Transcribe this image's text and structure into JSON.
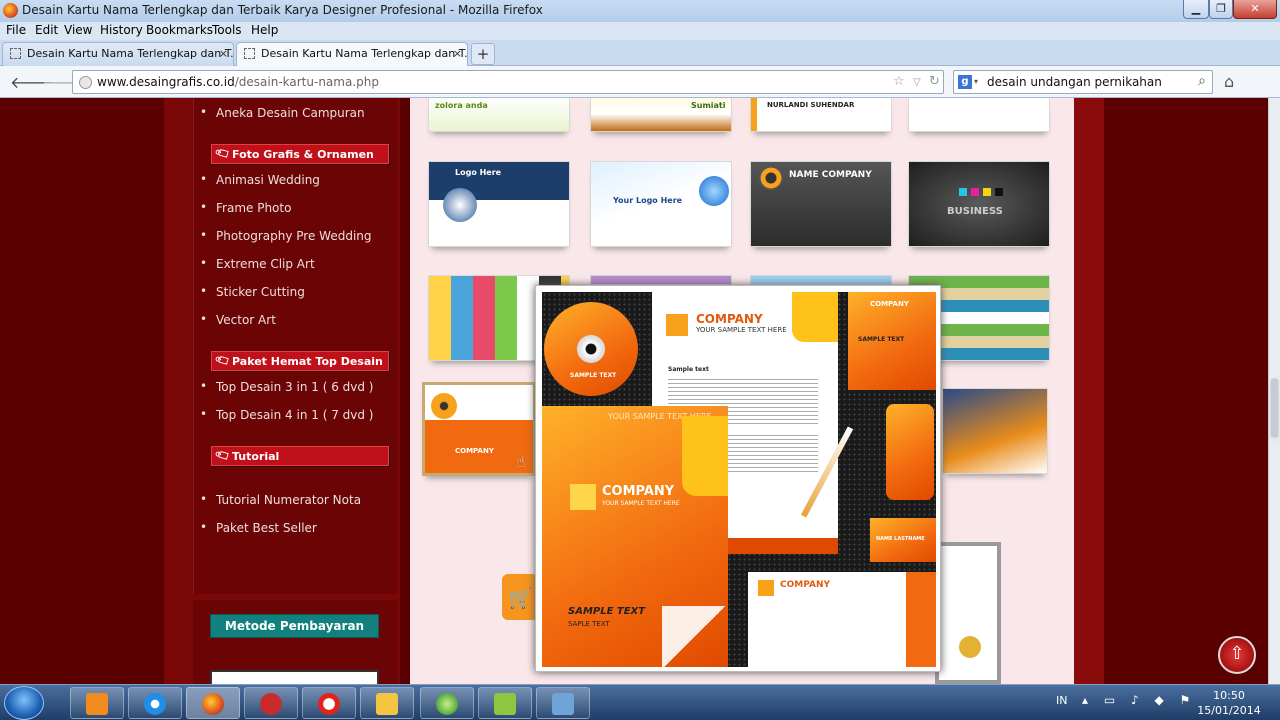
{
  "window": {
    "title": "Desain Kartu Nama Terlengkap dan Terbaik Karya Designer Profesional - Mozilla Firefox"
  },
  "menu": [
    "File",
    "Edit",
    "View",
    "History",
    "Bookmarks",
    "Tools",
    "Help"
  ],
  "tabs": [
    {
      "label": "Desain Kartu Nama Terlengkap dan T...",
      "close": "×"
    },
    {
      "label": "Desain Kartu Nama Terlengkap dan T...",
      "close": "×"
    }
  ],
  "newtab_label": "+",
  "nav": {
    "url_host": "www.desaingrafis.co.id",
    "url_path": "/desain-kartu-nama.php",
    "search_value": "desain undangan pernikahan",
    "search_engine_letter": "g"
  },
  "sidebar": {
    "top_item": "Aneka Desain Campuran",
    "sections": [
      {
        "title": "Foto Grafis & Ornamen",
        "items": [
          "Animasi Wedding",
          "Frame Photo",
          "Photography Pre Wedding",
          "Extreme Clip Art",
          "Sticker Cutting",
          "Vector Art"
        ]
      },
      {
        "title": "Paket Hemat Top Desain",
        "items": [
          "Top Desain 3 in 1 ( 6 dvd )",
          "Top Desain 4 in 1 ( 7 dvd )"
        ]
      },
      {
        "title": "Tutorial",
        "items": [
          "Tutorial Numerator Nota",
          "Paket Best Seller"
        ]
      }
    ],
    "payment_button": "Metode Pembayaran"
  },
  "thumbs": {
    "row1_texts": [
      "zolora anda",
      "Sumiati",
      "NURLANDI SUHENDAR",
      ""
    ],
    "row2_texts": [
      "Logo Here",
      "Your Logo Here",
      "NAME COMPANY",
      "BUSINESS"
    ]
  },
  "popup": {
    "company": "COMPANY",
    "tagline": "YOUR SAMPLE TEXT HERE",
    "sample_text": "SAMPLE TEXT",
    "sample_sub": "SAPLE TEXT",
    "name_lastname": "NAME LASTNAME",
    "letter_title": "Sample text"
  },
  "taskbar": {
    "lang": "IN",
    "time": "10:50",
    "date": "15/01/2014"
  },
  "colors": {
    "page_bg": "#5a0000",
    "sidebar_head": "#c0101a",
    "pay_button": "#12807c",
    "popup_orange": "#f26a0f"
  }
}
